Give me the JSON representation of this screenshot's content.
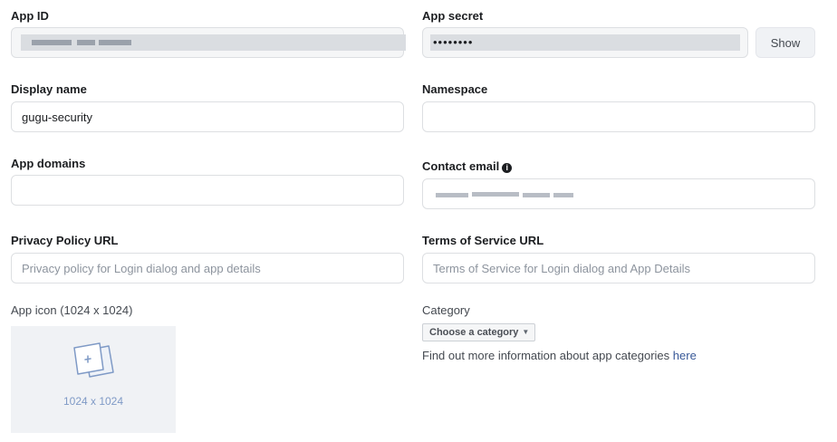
{
  "app_id": {
    "label": "App ID",
    "value_obscured": true
  },
  "app_secret": {
    "label": "App secret",
    "masked_value": "••••••••",
    "show_button": "Show"
  },
  "display_name": {
    "label": "Display name",
    "value": "gugu-security"
  },
  "namespace": {
    "label": "Namespace",
    "value": ""
  },
  "app_domains": {
    "label": "App domains",
    "value": ""
  },
  "contact_email": {
    "label": "Contact email",
    "info_glyph": "i",
    "value_obscured": true
  },
  "privacy_policy": {
    "label": "Privacy Policy URL",
    "placeholder": "Privacy policy for Login dialog and app details"
  },
  "terms_of_service": {
    "label": "Terms of Service URL",
    "placeholder": "Terms of Service for Login dialog and App Details"
  },
  "app_icon": {
    "label": "App icon (1024 x 1024)",
    "dimensions": "1024 x 1024",
    "icon": "image-upload-icon"
  },
  "category": {
    "label": "Category",
    "select_label": "Choose a category",
    "caret_glyph": "▼",
    "help_text": "Find out more information about app categories ",
    "help_link": "here"
  },
  "colors": {
    "link": "#385898",
    "icon_tint": "#7f9ac6",
    "field_border": "#dddfe2"
  }
}
